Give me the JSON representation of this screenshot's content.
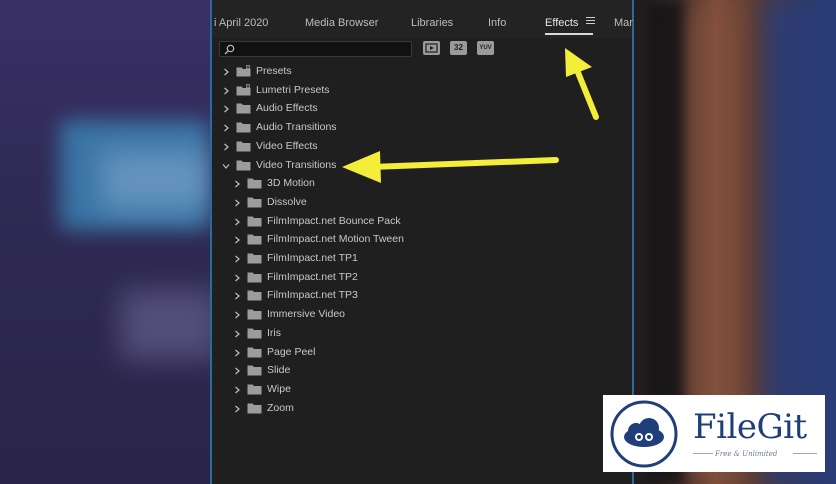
{
  "tabs": [
    {
      "label": "i April 2020",
      "active": false
    },
    {
      "label": "Media Browser",
      "active": false
    },
    {
      "label": "Libraries",
      "active": false
    },
    {
      "label": "Info",
      "active": false
    },
    {
      "label": "Effects",
      "active": true
    },
    {
      "label": "Mar",
      "active": false
    }
  ],
  "search": {
    "placeholder": "",
    "value": ""
  },
  "toolbar": {
    "accelerated_icon": "accelerated-effects-icon",
    "bit32_label": "32",
    "yuv_label": "YUV"
  },
  "tree": {
    "top_level": [
      {
        "label": "Presets",
        "icon": "preset-folder-icon",
        "expanded": false
      },
      {
        "label": "Lumetri Presets",
        "icon": "preset-folder-icon",
        "expanded": false
      },
      {
        "label": "Audio Effects",
        "icon": "folder-icon",
        "expanded": false
      },
      {
        "label": "Audio Transitions",
        "icon": "folder-icon",
        "expanded": false
      },
      {
        "label": "Video Effects",
        "icon": "folder-icon",
        "expanded": false
      },
      {
        "label": "Video Transitions",
        "icon": "folder-icon",
        "expanded": true
      }
    ],
    "video_transitions_children": [
      "3D Motion",
      "Dissolve",
      "FilmImpact.net Bounce Pack",
      "FilmImpact.net Motion Tween",
      "FilmImpact.net TP1",
      "FilmImpact.net TP2",
      "FilmImpact.net TP3",
      "Immersive Video",
      "Iris",
      "Page Peel",
      "Slide",
      "Wipe",
      "Zoom"
    ]
  },
  "annotations": {
    "arrow_color": "#f3ee3a"
  },
  "watermark": {
    "name": "FileGit",
    "tagline": "Free & Unlimited",
    "color": "#1f3e7a"
  }
}
